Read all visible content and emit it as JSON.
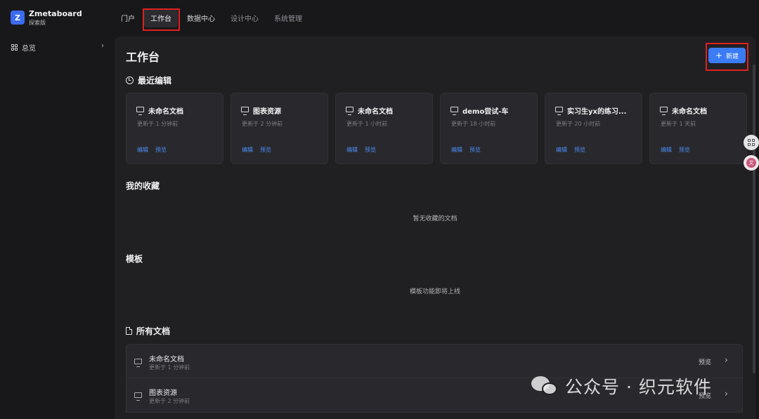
{
  "brand": {
    "logo_letter": "Z",
    "name": "Zmetaboard",
    "subtitle": "探索版",
    "accent": "#3b6bf0"
  },
  "nav": {
    "items": [
      {
        "label": "门户"
      },
      {
        "label": "工作台"
      },
      {
        "label": "数据中心"
      },
      {
        "label": "设计中心"
      },
      {
        "label": "系统管理"
      }
    ],
    "active": "工作台"
  },
  "sidebar": {
    "items": [
      {
        "label": "总览",
        "icon": "grid-icon"
      }
    ]
  },
  "main": {
    "title": "工作台",
    "new_button": {
      "label": "新建",
      "icon": "plus-icon",
      "color": "#3b7cf5"
    },
    "recent": {
      "title": "最近编辑",
      "cards": [
        {
          "title": "未命名文档",
          "time": "更新于 1 分钟前",
          "edit": "编辑",
          "preview": "预览"
        },
        {
          "title": "图表资源",
          "time": "更新于 2 分钟前",
          "edit": "编辑",
          "preview": "预览"
        },
        {
          "title": "未命名文档",
          "time": "更新于 1 小时前",
          "edit": "编辑",
          "preview": "预览"
        },
        {
          "title": "demo尝试-车",
          "time": "更新于 18 小时前",
          "edit": "编辑",
          "preview": "预览"
        },
        {
          "title": "实习生yx的练习...",
          "time": "更新于 20 小时前",
          "edit": "编辑",
          "preview": "预览"
        },
        {
          "title": "未命名文档",
          "time": "更新于 1 天前",
          "edit": "编辑",
          "preview": "预览"
        }
      ]
    },
    "favorites": {
      "title": "我的收藏",
      "empty": "暂无收藏的文档"
    },
    "templates": {
      "title": "模板",
      "empty": "模板功能即将上线"
    },
    "all_docs": {
      "title": "所有文档",
      "rows": [
        {
          "name": "未命名文档",
          "time": "更新于 1 分钟前",
          "action": "预览"
        },
        {
          "name": "图表资源",
          "time": "更新于 2 分钟前",
          "action": "预览"
        }
      ]
    }
  },
  "watermark": {
    "text": "公众号 · 织元软件"
  }
}
